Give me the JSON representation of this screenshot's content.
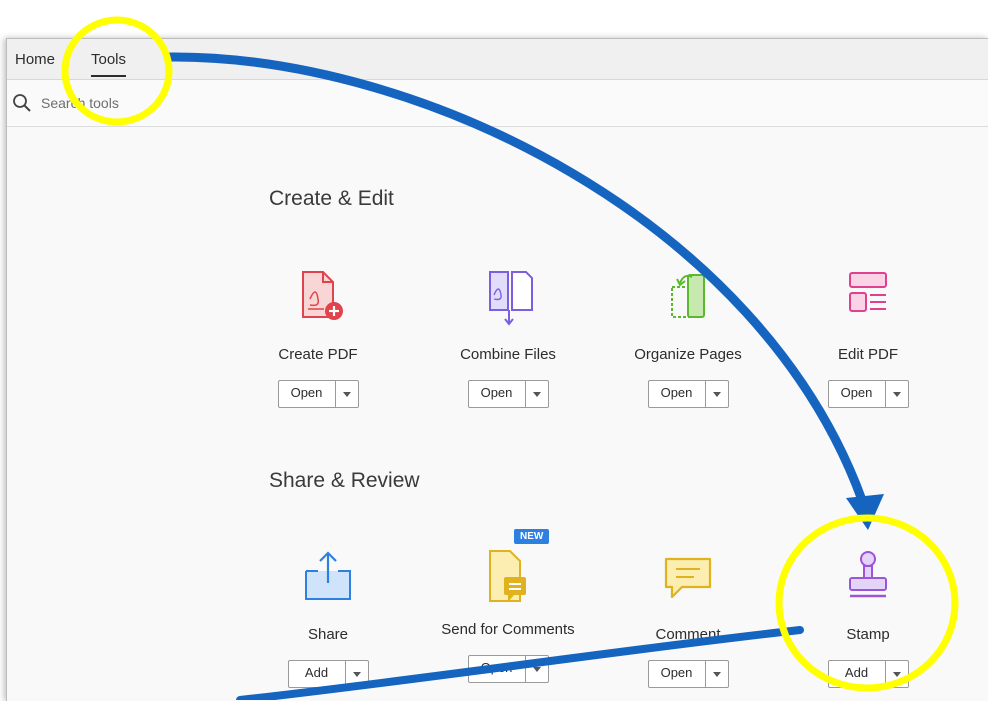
{
  "tabs": {
    "home": "Home",
    "tools": "Tools"
  },
  "search": {
    "placeholder": "Search tools"
  },
  "sections": {
    "create_edit": {
      "title": "Create & Edit",
      "tools": [
        {
          "label": "Create PDF",
          "button": "Open"
        },
        {
          "label": "Combine Files",
          "button": "Open"
        },
        {
          "label": "Organize Pages",
          "button": "Open"
        },
        {
          "label": "Edit PDF",
          "button": "Open"
        }
      ]
    },
    "share_review": {
      "title": "Share & Review",
      "tools": [
        {
          "label": "Share",
          "button": "Add"
        },
        {
          "label": "Send for Comments",
          "button": "Open",
          "badge": "NEW"
        },
        {
          "label": "Comment",
          "button": "Open"
        },
        {
          "label": "Stamp",
          "button": "Add"
        }
      ]
    }
  },
  "annotation_colors": {
    "highlight": "#ffff00",
    "arrow": "#1565c0"
  }
}
